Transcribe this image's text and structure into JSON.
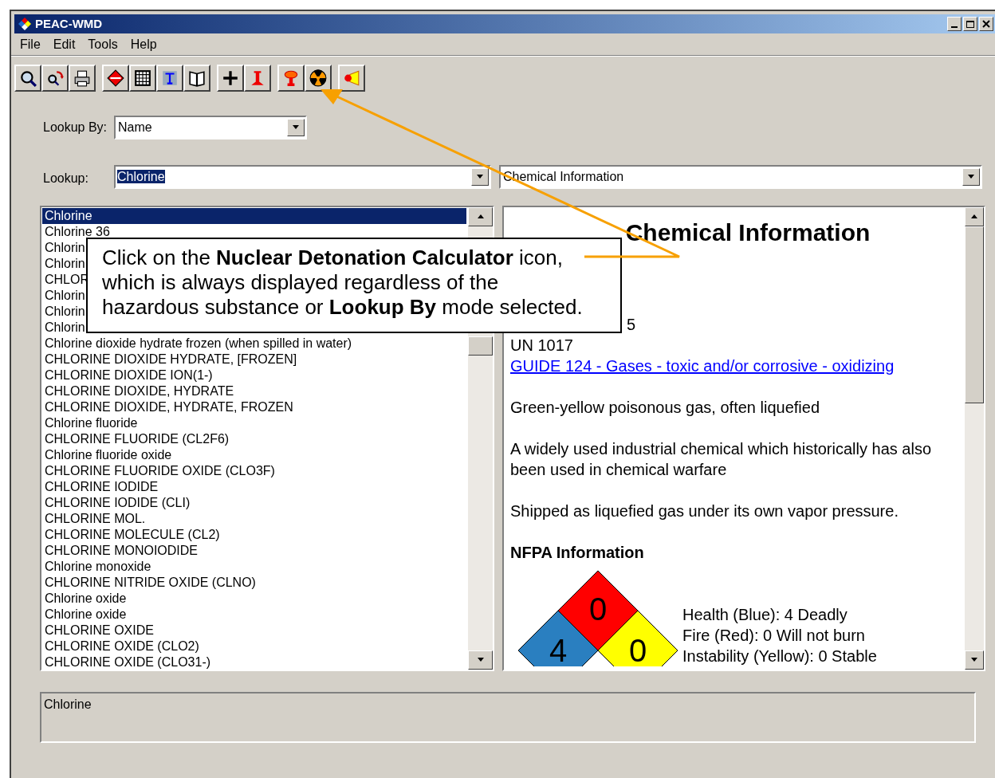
{
  "window": {
    "title": "PEAC-WMD"
  },
  "menu": [
    {
      "label": "File"
    },
    {
      "label": "Edit"
    },
    {
      "label": "Tools"
    },
    {
      "label": "Help"
    }
  ],
  "lookup_by": {
    "label": "Lookup By:",
    "value": "Name"
  },
  "lookup": {
    "label": "Lookup:",
    "value": "Chlorine"
  },
  "info_select": {
    "value": "Chemical Information"
  },
  "results": [
    {
      "text": "Chlorine",
      "selected": true
    },
    {
      "text": "Chlorine 36",
      "selected": false
    },
    {
      "text": "Chlorin",
      "selected": false
    },
    {
      "text": "Chlorin",
      "selected": false
    },
    {
      "text": "CHLOR",
      "selected": false
    },
    {
      "text": "Chlorin",
      "selected": false
    },
    {
      "text": "Chlorin",
      "selected": false
    },
    {
      "text": "Chlorin",
      "selected": false
    },
    {
      "text": "Chlorine dioxide hydrate frozen (when spilled in water)",
      "selected": false
    },
    {
      "text": "CHLORINE DIOXIDE HYDRATE, [FROZEN]",
      "selected": false
    },
    {
      "text": "CHLORINE DIOXIDE ION(1-)",
      "selected": false
    },
    {
      "text": "CHLORINE DIOXIDE, HYDRATE",
      "selected": false
    },
    {
      "text": "CHLORINE DIOXIDE, HYDRATE, FROZEN",
      "selected": false
    },
    {
      "text": "Chlorine fluoride",
      "selected": false
    },
    {
      "text": "CHLORINE FLUORIDE (CL2F6)",
      "selected": false
    },
    {
      "text": "Chlorine fluoride oxide",
      "selected": false
    },
    {
      "text": "CHLORINE FLUORIDE OXIDE (CLO3F)",
      "selected": false
    },
    {
      "text": "CHLORINE IODIDE",
      "selected": false
    },
    {
      "text": "CHLORINE IODIDE (CLI)",
      "selected": false
    },
    {
      "text": "CHLORINE MOL.",
      "selected": false
    },
    {
      "text": "CHLORINE MOLECULE (CL2)",
      "selected": false
    },
    {
      "text": "CHLORINE MONOIODIDE",
      "selected": false
    },
    {
      "text": "Chlorine monoxide",
      "selected": false
    },
    {
      "text": "CHLORINE NITRIDE OXIDE (CLNO)",
      "selected": false
    },
    {
      "text": "Chlorine oxide",
      "selected": false
    },
    {
      "text": "Chlorine oxide",
      "selected": false
    },
    {
      "text": "CHLORINE OXIDE",
      "selected": false
    },
    {
      "text": "CHLORINE OXIDE (CLO2)",
      "selected": false
    },
    {
      "text": "CHLORINE OXIDE (CLO31-)",
      "selected": false
    }
  ],
  "info": {
    "heading": "Chemical Information",
    "fragment": "5",
    "un": "UN 1017",
    "guide_link": "GUIDE 124 - Gases - toxic and/or corrosive - oxidizing",
    "paragraphs": [
      "Green-yellow poisonous gas, often liquefied",
      "A widely used industrial chemical which historically has also been used in chemical warfare",
      "Shipped as liquefied gas under its own vapor pressure."
    ],
    "nfpa_heading": "NFPA Information",
    "nfpa": {
      "health": "4",
      "fire": "0",
      "instability": "0"
    },
    "nfpa_lines": [
      "Health (Blue): 4 Deadly",
      "Fire (Red): 0 Will not burn",
      "Instability (Yellow): 0 Stable"
    ]
  },
  "status_text": "Chlorine",
  "callout": {
    "text": "Click on the **Nuclear Detonation Calculator** icon, which is always displayed regardless of the hazardous substance or **Lookup By** mode selected."
  }
}
